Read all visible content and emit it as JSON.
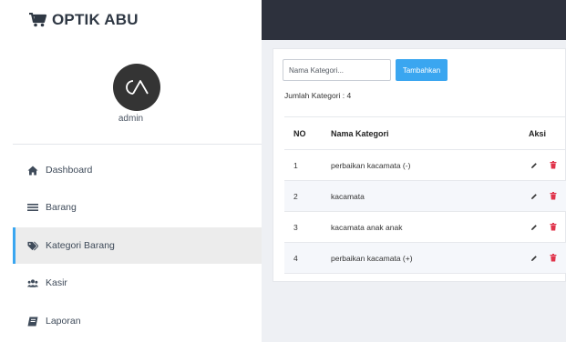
{
  "sidebar": {
    "brand": "OPTIK ABU",
    "username": "admin",
    "items": [
      {
        "label": "Dashboard"
      },
      {
        "label": "Barang"
      },
      {
        "label": "Kategori Barang"
      },
      {
        "label": "Kasir"
      },
      {
        "label": "Laporan"
      }
    ]
  },
  "main": {
    "search_placeholder": "Nama Kategori...",
    "add_label": "Tambahkan",
    "count_label": "Jumlah Kategori : 4",
    "table": {
      "headers": {
        "no": "NO",
        "name": "Nama Kategori",
        "action": "Aksi"
      },
      "rows": [
        {
          "no": "1",
          "name": "perbaikan kacamata (-)"
        },
        {
          "no": "2",
          "name": "kacamata"
        },
        {
          "no": "3",
          "name": "kacamata anak anak"
        },
        {
          "no": "4",
          "name": "perbaikan kacamata (+)"
        }
      ]
    }
  },
  "colors": {
    "accent": "#3aa6f0",
    "topbar": "#2d313d",
    "delete": "#e0344b",
    "active_item_bg": "#ececec"
  },
  "icons": {
    "brand": "cart-icon",
    "nav": [
      "home-icon",
      "list-icon",
      "tag-icon",
      "users-icon",
      "book-icon"
    ],
    "row_actions": [
      "pencil-icon",
      "trash-icon"
    ]
  }
}
